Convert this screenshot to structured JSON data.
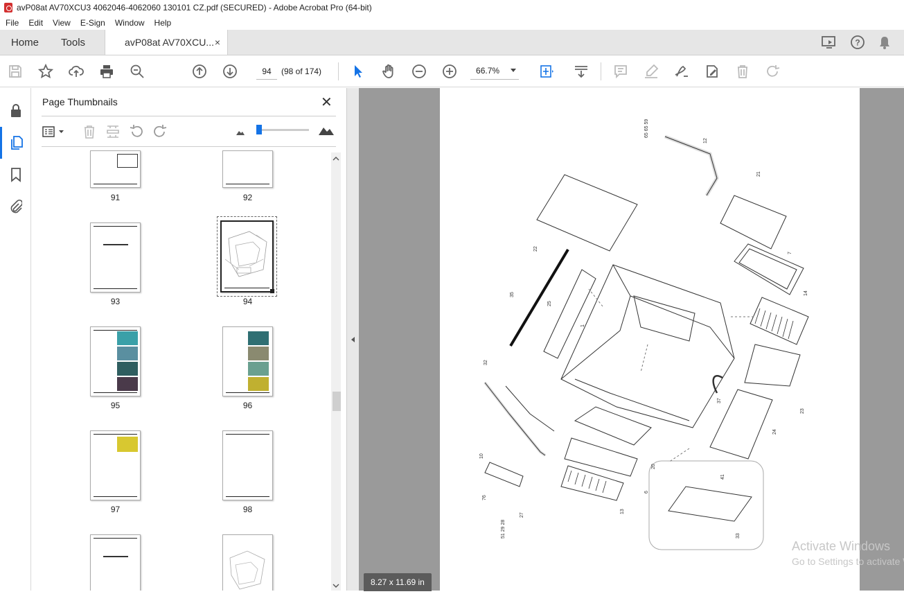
{
  "window": {
    "title": "avP08at AV70XCU3 4062046-4062060 130101 CZ.pdf (SECURED) - Adobe Acrobat Pro (64-bit)"
  },
  "menu": [
    "File",
    "Edit",
    "View",
    "E-Sign",
    "Window",
    "Help"
  ],
  "tabs": {
    "home": "Home",
    "tools": "Tools",
    "document": "avP08at AV70XCU...",
    "close": "×"
  },
  "toolbar": {
    "page_input": "94",
    "page_count": "(98 of 174)",
    "zoom": "66.7%"
  },
  "panel": {
    "title": "Page Thumbnails",
    "close": "✕",
    "thumbnails": [
      {
        "label": "91"
      },
      {
        "label": "92"
      },
      {
        "label": "93"
      },
      {
        "label": "94"
      },
      {
        "label": "95"
      },
      {
        "label": "96"
      },
      {
        "label": "97"
      },
      {
        "label": "98"
      },
      {
        "label": ""
      },
      {
        "label": ""
      }
    ],
    "selected_page": "94"
  },
  "document": {
    "page_size": "8.27 x 11.69 in"
  },
  "watermark": {
    "line1": "Activate Windows",
    "line2": "Go to Settings to activate Windows."
  },
  "icons": [
    "save-icon",
    "star-icon",
    "upload-icon",
    "print-icon",
    "zoom-search-icon",
    "page-up-icon",
    "page-down-icon",
    "select-cursor-icon",
    "hand-icon",
    "zoom-out-icon",
    "zoom-in-icon",
    "fit-page-icon",
    "scroll-mode-icon",
    "comment-icon",
    "highlight-icon",
    "sign-icon",
    "edit-icon",
    "delete-icon",
    "redo-icon"
  ]
}
